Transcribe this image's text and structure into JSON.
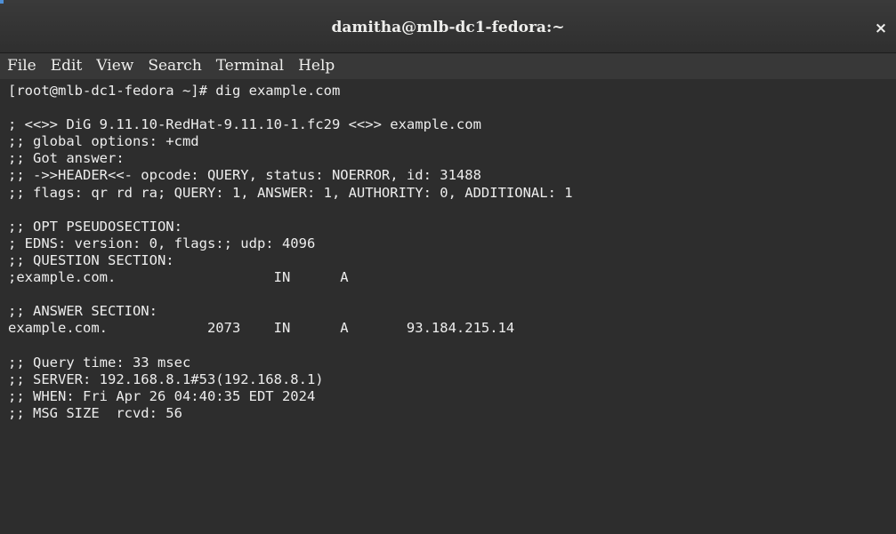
{
  "window": {
    "title": "damitha@mlb-dc1-fedora:~",
    "close_label": "×"
  },
  "menubar": {
    "items": [
      "File",
      "Edit",
      "View",
      "Search",
      "Terminal",
      "Help"
    ]
  },
  "terminal": {
    "lines": [
      "[root@mlb-dc1-fedora ~]# dig example.com",
      "",
      "; <<>> DiG 9.11.10-RedHat-9.11.10-1.fc29 <<>> example.com",
      ";; global options: +cmd",
      ";; Got answer:",
      ";; ->>HEADER<<- opcode: QUERY, status: NOERROR, id: 31488",
      ";; flags: qr rd ra; QUERY: 1, ANSWER: 1, AUTHORITY: 0, ADDITIONAL: 1",
      "",
      ";; OPT PSEUDOSECTION:",
      "; EDNS: version: 0, flags:; udp: 4096",
      ";; QUESTION SECTION:",
      ";example.com.                   IN      A",
      "",
      ";; ANSWER SECTION:",
      "example.com.            2073    IN      A       93.184.215.14",
      "",
      ";; Query time: 33 msec",
      ";; SERVER: 192.168.8.1#53(192.168.8.1)",
      ";; WHEN: Fri Apr 26 04:40:35 EDT 2024",
      ";; MSG SIZE  rcvd: 56"
    ]
  }
}
